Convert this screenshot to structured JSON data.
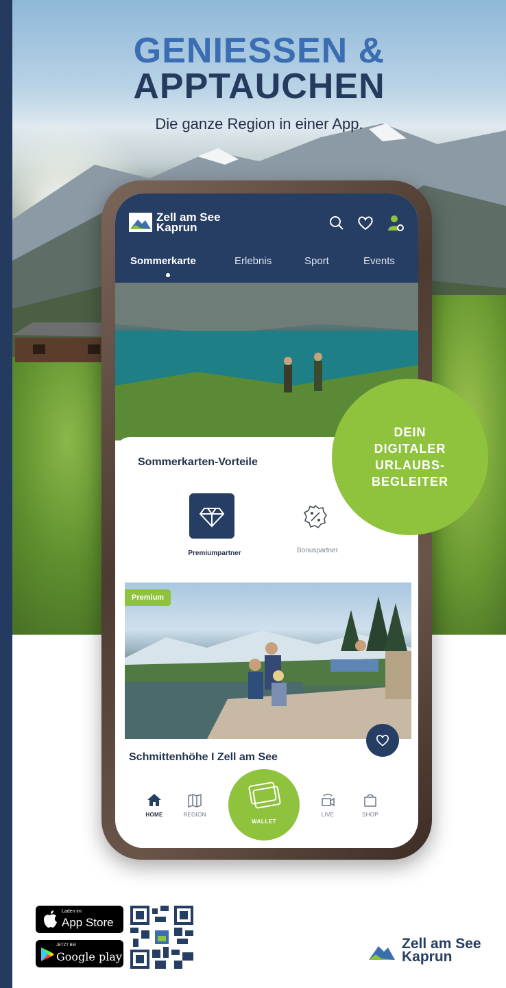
{
  "poster": {
    "headline_line1": "GENIESSEN &",
    "headline_line2": "APPTAUCHEN",
    "subline": "Die ganze Region in einer App.",
    "badge_lines": [
      "DEIN",
      "DIGITALER",
      "URLAUBS-",
      "BEGLEITER"
    ],
    "colors": {
      "navy": "#263d64",
      "blue": "#3b6db2",
      "green": "#8fc23d"
    }
  },
  "app": {
    "brand_line1": "Zell am See",
    "brand_line2": "Kaprun",
    "header_icons": [
      "search-icon",
      "heart-icon",
      "user-icon"
    ],
    "tabs": [
      {
        "label": "Sommerkarte",
        "active": true
      },
      {
        "label": "Erlebnis",
        "active": false
      },
      {
        "label": "Sport",
        "active": false
      },
      {
        "label": "Events",
        "active": false
      }
    ],
    "section_title": "Sommerkarten-Vorteile",
    "partners": [
      {
        "label": "Premiumpartner",
        "icon": "diamond-icon",
        "selected": true
      },
      {
        "label": "Bonuspartner",
        "icon": "percent-badge-icon",
        "selected": false
      }
    ],
    "card": {
      "badge": "Premium",
      "title": "Schmittenhöhe I Zell am See",
      "favorite_icon": "heart-icon"
    },
    "bottom_nav": [
      {
        "label": "HOME",
        "icon": "home-icon",
        "active": true
      },
      {
        "label": "REGION",
        "icon": "map-icon",
        "active": false
      },
      {
        "label": "WALLET",
        "icon": "wallet-icon",
        "active": false
      },
      {
        "label": "LIVE",
        "icon": "webcam-icon",
        "active": false
      },
      {
        "label": "SHOP",
        "icon": "shopping-bag-icon",
        "active": false
      }
    ]
  },
  "footer": {
    "app_store_small": "Laden im",
    "app_store_big": "App Store",
    "google_small": "JETZT BEI",
    "google_big": "Google play",
    "brand_line1": "Zell am See",
    "brand_line2": "Kaprun"
  }
}
